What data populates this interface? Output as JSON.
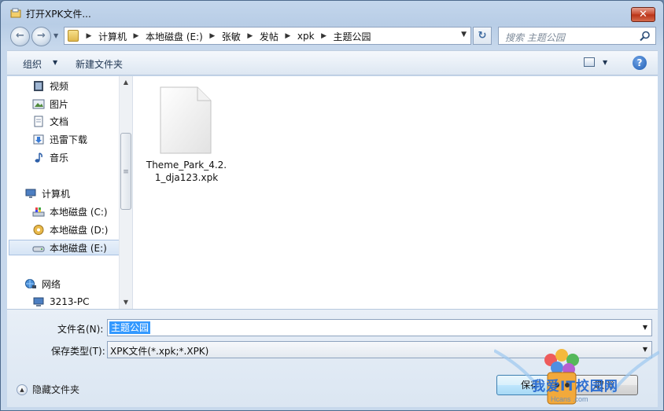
{
  "window": {
    "title": "打开XPK文件...",
    "close_label": "✕"
  },
  "nav": {
    "back_label": "←",
    "forward_label": "→",
    "history_dropdown": "▼",
    "refresh_label": "↻"
  },
  "address": {
    "crumbs": [
      "计算机",
      "本地磁盘 (E:)",
      "张敏",
      "发帖",
      "xpk",
      "主题公园"
    ],
    "separator": "▶",
    "dropdown": "▼"
  },
  "search": {
    "placeholder": "搜索 主题公园"
  },
  "toolbar": {
    "organize_label": "组织",
    "organize_arrow": "▼",
    "new_folder_label": "新建文件夹",
    "view_arrow": "▼",
    "help_label": "?"
  },
  "navpane": {
    "items": [
      {
        "label": "视频",
        "icon": "video-icon"
      },
      {
        "label": "图片",
        "icon": "pictures-icon"
      },
      {
        "label": "文档",
        "icon": "documents-icon"
      },
      {
        "label": "迅雷下载",
        "icon": "download-icon"
      },
      {
        "label": "音乐",
        "icon": "music-icon"
      },
      {
        "label": "计算机",
        "icon": "computer-icon"
      },
      {
        "label": "本地磁盘 (C:)",
        "icon": "drive-c-icon"
      },
      {
        "label": "本地磁盘 (D:)",
        "icon": "drive-d-icon"
      },
      {
        "label": "本地磁盘 (E:)",
        "icon": "drive-e-icon",
        "selected": true
      },
      {
        "label": "网络",
        "icon": "network-icon"
      },
      {
        "label": "3213-PC",
        "icon": "pc-icon"
      }
    ],
    "scroll_up": "▲",
    "scroll_down": "▼",
    "scroll_grip": "≡"
  },
  "files": [
    {
      "name": "Theme_Park_4.2.1_dja123.xpk",
      "icon": "generic-file-icon"
    }
  ],
  "bottom": {
    "filename_label": "文件名(N):",
    "filename_value": "主题公园",
    "filetype_label": "保存类型(T):",
    "filetype_value": "XPK文件(*.xpk;*.XPK)",
    "hide_folders_label": "隐藏文件夹",
    "save_button": "保存",
    "cancel_button": "取消"
  },
  "watermark": {
    "text": "我爱IT校园网",
    "sub": "Hcans .com"
  }
}
